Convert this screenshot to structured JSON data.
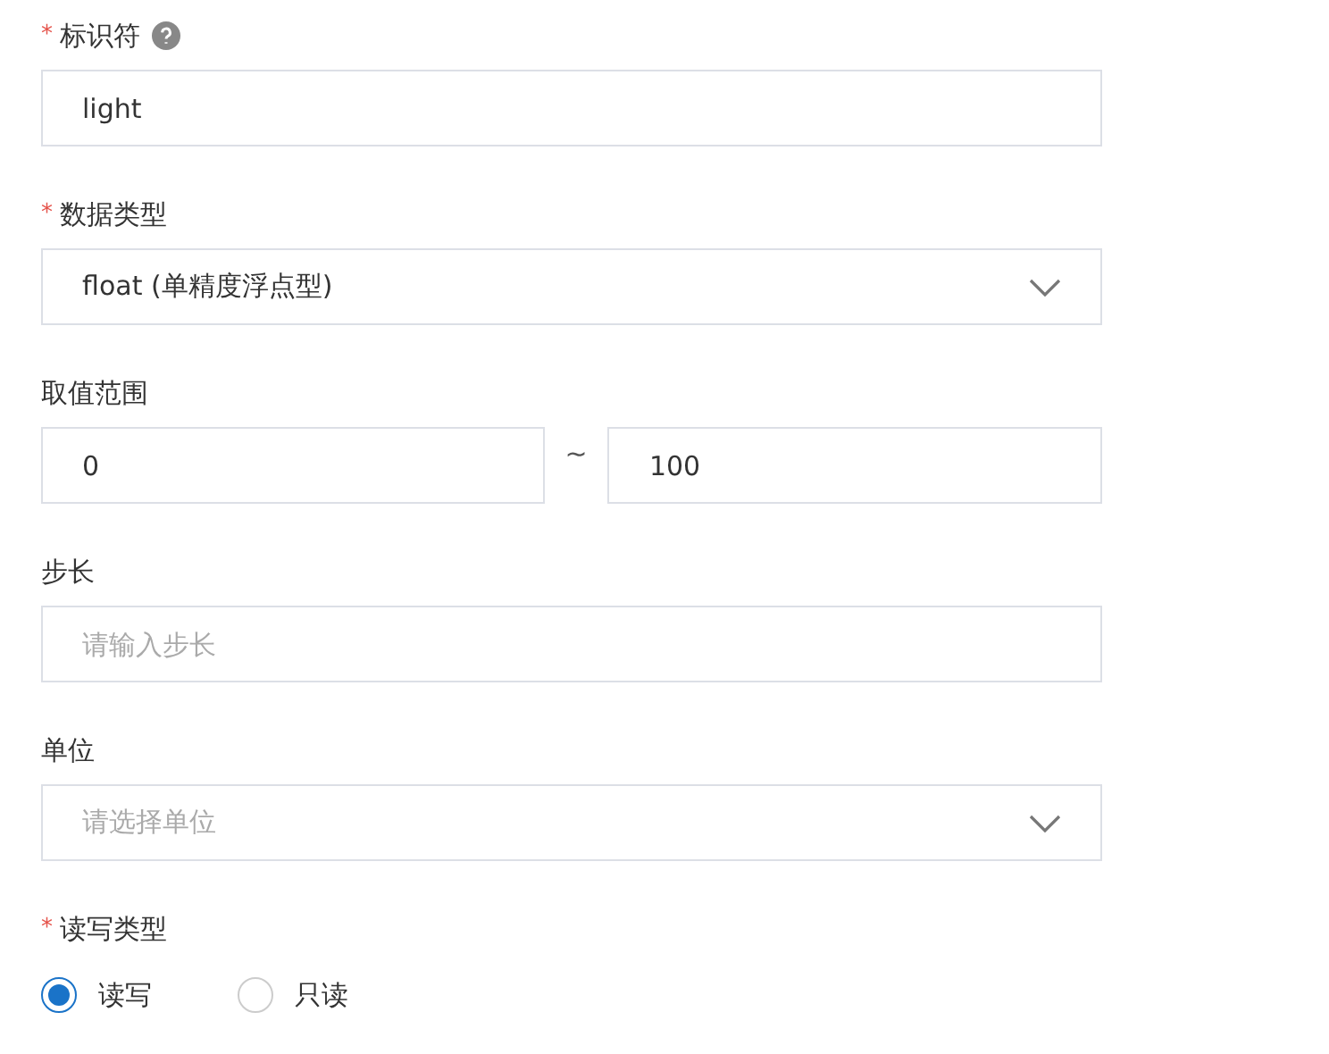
{
  "fields": [
    {
      "kind": "input",
      "required_mark": "*",
      "label": "标识符",
      "help_icon": true,
      "value": "light"
    },
    {
      "kind": "select",
      "required_mark": "*",
      "label": "数据类型",
      "help_icon": false,
      "value": "float (单精度浮点型)"
    },
    {
      "kind": "range",
      "label": "取值范围",
      "help_icon": false,
      "min": "0",
      "separator": "~",
      "max": "100"
    },
    {
      "kind": "input",
      "label": "步长",
      "help_icon": false,
      "placeholder": "请输入步长"
    },
    {
      "kind": "select",
      "label": "单位",
      "help_icon": false,
      "placeholder": "请选择单位"
    },
    {
      "kind": "radio",
      "required_mark": "*",
      "label": "读写类型",
      "help_icon": false,
      "options": [
        {
          "label": "读写",
          "selected": true
        },
        {
          "label": "只读",
          "selected": false
        }
      ]
    }
  ]
}
